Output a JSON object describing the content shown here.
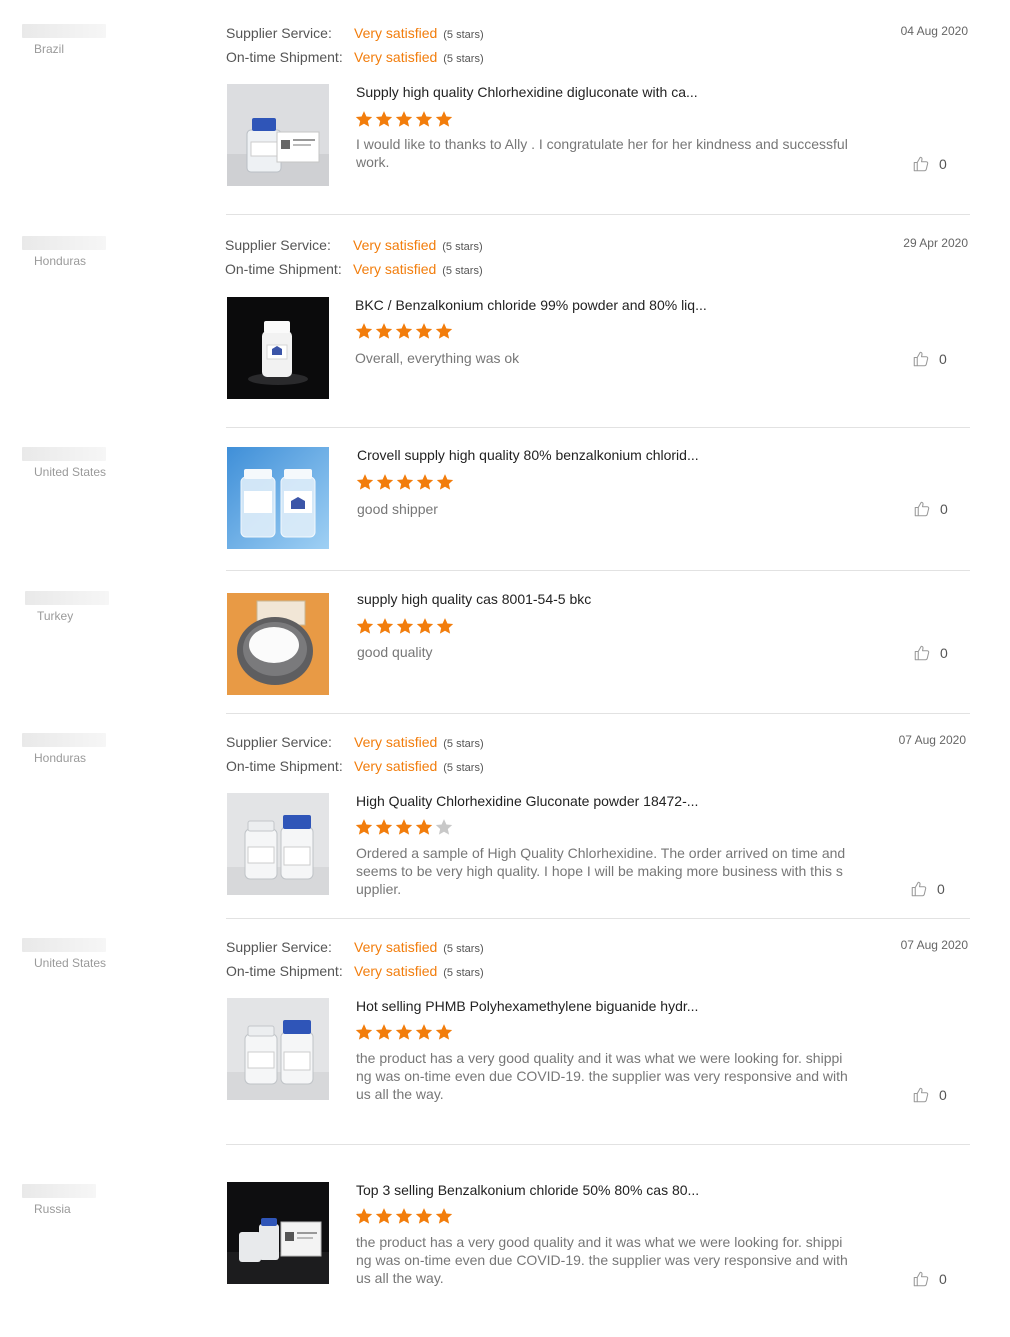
{
  "labels": {
    "supplier_service": "Supplier Service:",
    "ontime_shipment": "On-time Shipment:"
  },
  "colors": {
    "accent": "#f27d0c",
    "star_empty": "#c8c8c8"
  },
  "icons": {
    "like": "thumbs-up-icon",
    "star": "star-icon"
  },
  "reviews": [
    {
      "country": "Brazil",
      "date": "04 Aug 2020",
      "supplier_service": "Very satisfied",
      "supplier_service_stars": "(5 stars)",
      "shipment": "Very satisfied",
      "shipment_stars": "(5 stars)",
      "product": "Supply high quality Chlorhexidine digluconate with ca...",
      "rating": 5,
      "comment": "I would like to thanks to Ally .  I congratulate her for her kindness and successful work.",
      "likes": "0"
    },
    {
      "country": "Honduras",
      "date": "29 Apr 2020",
      "supplier_service": "Very satisfied",
      "supplier_service_stars": "(5 stars)",
      "shipment": "Very satisfied",
      "shipment_stars": "(5 stars)",
      "product": "BKC / Benzalkonium chloride 99% powder and 80% liq...",
      "rating": 5,
      "comment": "Overall, everything was ok",
      "likes": "0"
    },
    {
      "country": "United States",
      "product": "Crovell supply high quality 80% benzalkonium chlorid...",
      "rating": 5,
      "comment": "good shipper",
      "likes": "0"
    },
    {
      "country": "Turkey",
      "product": "supply high quality cas 8001-54-5 bkc",
      "rating": 5,
      "comment": "good quality",
      "likes": "0"
    },
    {
      "country": "Honduras",
      "date": "07 Aug 2020",
      "supplier_service": "Very satisfied",
      "supplier_service_stars": "(5 stars)",
      "shipment": "Very satisfied",
      "shipment_stars": "(5 stars)",
      "product": "High Quality Chlorhexidine Gluconate powder 18472-...",
      "rating": 4,
      "comment": "Ordered a sample of High Quality Chlorhexidine. The order arrived on time and seems to be very high quality. I hope I will be making more business with this supplier.",
      "likes": "0"
    },
    {
      "country": "United States",
      "date": "07 Aug 2020",
      "supplier_service": "Very satisfied",
      "supplier_service_stars": "(5 stars)",
      "shipment": "Very satisfied",
      "shipment_stars": "(5 stars)",
      "product": "Hot selling PHMB Polyhexamethylene biguanide hydr...",
      "rating": 5,
      "comment": "the product has a very good quality and it was what we were looking for. shipping was on-time even due COVID-19. the supplier was very responsive and with us all the way.",
      "likes": "0"
    },
    {
      "country": "Russia",
      "product": "Top 3 selling Benzalkonium chloride 50% 80% cas 80...",
      "rating": 5,
      "comment": "the product has a very good quality and it was what we were looking for. shipping was on-time even due COVID-19. the supplier was very responsive and with us all the way.",
      "likes": "0"
    }
  ]
}
